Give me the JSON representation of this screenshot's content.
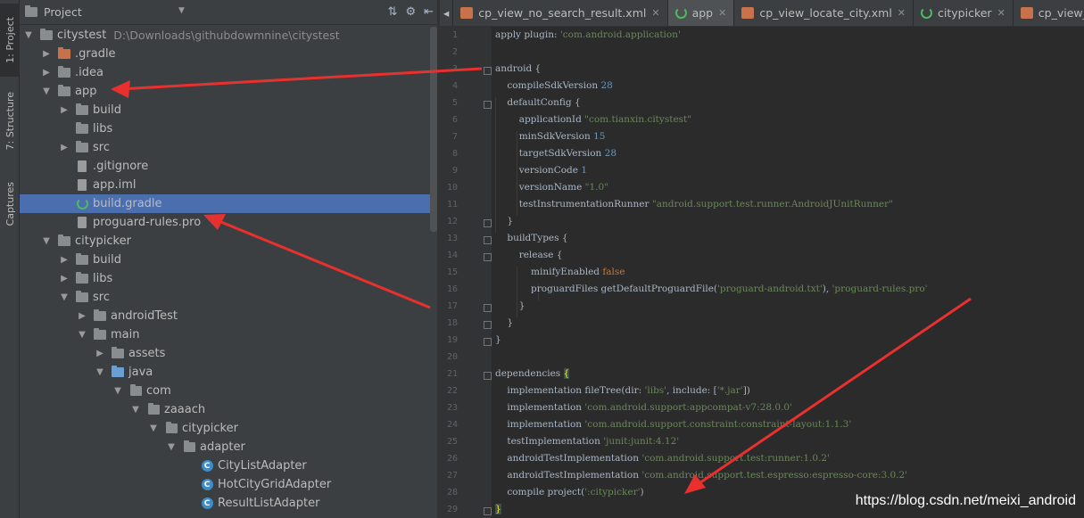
{
  "toolstrip": {
    "tabs": [
      {
        "label": "1: Project"
      },
      {
        "label": "7: Structure"
      },
      {
        "label": "Captures"
      }
    ]
  },
  "project_panel": {
    "title": "Project",
    "root_path": "D:\\Downloads\\githubdowmnine\\citystest",
    "tree": [
      {
        "label": "citystest",
        "depth": 0,
        "expanded": "open",
        "icon": "module-folder-icon"
      },
      {
        "label": ".gradle",
        "depth": 1,
        "expanded": "closed",
        "icon": "orange-folder-icon"
      },
      {
        "label": ".idea",
        "depth": 1,
        "expanded": "closed",
        "icon": "folder-icon"
      },
      {
        "label": "app",
        "depth": 1,
        "expanded": "open",
        "icon": "module-folder-icon"
      },
      {
        "label": "build",
        "depth": 2,
        "expanded": "closed",
        "icon": "folder-icon"
      },
      {
        "label": "libs",
        "depth": 2,
        "expanded": "none",
        "icon": "folder-icon"
      },
      {
        "label": "src",
        "depth": 2,
        "expanded": "closed",
        "icon": "folder-icon"
      },
      {
        "label": ".gitignore",
        "depth": 2,
        "expanded": "none",
        "icon": "file-icon"
      },
      {
        "label": "app.iml",
        "depth": 2,
        "expanded": "none",
        "icon": "file-icon"
      },
      {
        "label": "build.gradle",
        "depth": 2,
        "expanded": "none",
        "icon": "gradle-icon",
        "selected": true
      },
      {
        "label": "proguard-rules.pro",
        "depth": 2,
        "expanded": "none",
        "icon": "file-icon"
      },
      {
        "label": "citypicker",
        "depth": 1,
        "expanded": "open",
        "icon": "module-folder-icon"
      },
      {
        "label": "build",
        "depth": 2,
        "expanded": "closed",
        "icon": "folder-icon"
      },
      {
        "label": "libs",
        "depth": 2,
        "expanded": "closed",
        "icon": "folder-icon"
      },
      {
        "label": "src",
        "depth": 2,
        "expanded": "open",
        "icon": "folder-icon"
      },
      {
        "label": "androidTest",
        "depth": 3,
        "expanded": "closed",
        "icon": "folder-icon"
      },
      {
        "label": "main",
        "depth": 3,
        "expanded": "open",
        "icon": "folder-icon"
      },
      {
        "label": "assets",
        "depth": 4,
        "expanded": "closed",
        "icon": "folder-icon"
      },
      {
        "label": "java",
        "depth": 4,
        "expanded": "open",
        "icon": "blue-folder-icon"
      },
      {
        "label": "com",
        "depth": 5,
        "expanded": "open",
        "icon": "package-icon"
      },
      {
        "label": "zaaach",
        "depth": 6,
        "expanded": "open",
        "icon": "package-icon"
      },
      {
        "label": "citypicker",
        "depth": 7,
        "expanded": "open",
        "icon": "package-icon"
      },
      {
        "label": "adapter",
        "depth": 8,
        "expanded": "open",
        "icon": "package-icon"
      },
      {
        "label": "CityListAdapter",
        "depth": 9,
        "expanded": "none",
        "icon": "class-icon"
      },
      {
        "label": "HotCityGridAdapter",
        "depth": 9,
        "expanded": "none",
        "icon": "class-icon"
      },
      {
        "label": "ResultListAdapter",
        "depth": 9,
        "expanded": "none",
        "icon": "class-icon"
      }
    ]
  },
  "editor": {
    "tabs": [
      {
        "label": "cp_view_no_search_result.xml",
        "icon": "xml-icon",
        "active": false
      },
      {
        "label": "app",
        "icon": "gradle-icon",
        "active": true
      },
      {
        "label": "cp_view_locate_city.xml",
        "icon": "xml-icon",
        "active": false
      },
      {
        "label": "citypicker",
        "icon": "gradle-icon",
        "active": false
      },
      {
        "label": "cp_view_hot_city.",
        "icon": "xml-icon",
        "active": false
      }
    ],
    "line_numbers": [
      "1",
      "2",
      "3",
      "4",
      "5",
      "6",
      "7",
      "8",
      "9",
      "10",
      "11",
      "12",
      "13",
      "14",
      "15",
      "16",
      "17",
      "18",
      "19",
      "20",
      "21",
      "22",
      "23",
      "24",
      "25",
      "26",
      "27",
      "28",
      "29"
    ],
    "lines": [
      [
        {
          "t": "apply plugin: "
        },
        {
          "t": "'com.android.application'",
          "c": "str"
        }
      ],
      [],
      [
        {
          "t": "android {"
        }
      ],
      [
        {
          "t": "    compileSdkVersion "
        },
        {
          "t": "28",
          "c": "num"
        }
      ],
      [
        {
          "t": "    defaultConfig {"
        }
      ],
      [
        {
          "t": "        applicationId "
        },
        {
          "t": "\"com.tianxin.citystest\"",
          "c": "str"
        }
      ],
      [
        {
          "t": "        minSdkVersion "
        },
        {
          "t": "15",
          "c": "num"
        }
      ],
      [
        {
          "t": "        targetSdkVersion "
        },
        {
          "t": "28",
          "c": "num"
        }
      ],
      [
        {
          "t": "        versionCode "
        },
        {
          "t": "1",
          "c": "num"
        }
      ],
      [
        {
          "t": "        versionName "
        },
        {
          "t": "\"1.0\"",
          "c": "str"
        }
      ],
      [
        {
          "t": "        testInstrumentationRunner "
        },
        {
          "t": "\"android.support.test.runner.AndroidJUnitRunner\"",
          "c": "str"
        }
      ],
      [
        {
          "t": "    }"
        }
      ],
      [
        {
          "t": "    buildTypes {"
        }
      ],
      [
        {
          "t": "        release {"
        }
      ],
      [
        {
          "t": "            minifyEnabled "
        },
        {
          "t": "false",
          "c": "kw"
        }
      ],
      [
        {
          "t": "            proguardFiles getDefaultProguardFile("
        },
        {
          "t": "'proguard-android.txt'",
          "c": "str"
        },
        {
          "t": "), "
        },
        {
          "t": "'proguard-rules.pro'",
          "c": "str"
        }
      ],
      [
        {
          "t": "        }"
        }
      ],
      [
        {
          "t": "    }"
        }
      ],
      [
        {
          "t": "}"
        }
      ],
      [],
      [
        {
          "t": "dependencies "
        },
        {
          "t": "{",
          "c": "brace-hl"
        }
      ],
      [
        {
          "t": "    implementation fileTree(dir: "
        },
        {
          "t": "'libs'",
          "c": "str"
        },
        {
          "t": ", include: ["
        },
        {
          "t": "'*.jar'",
          "c": "str"
        },
        {
          "t": "])"
        }
      ],
      [
        {
          "t": "    implementation "
        },
        {
          "t": "'com.android.support:appcompat-v7:28.0.0'",
          "c": "str"
        }
      ],
      [
        {
          "t": "    implementation "
        },
        {
          "t": "'com.android.support.constraint:constraint-layout:1.1.3'",
          "c": "str"
        }
      ],
      [
        {
          "t": "    testImplementation "
        },
        {
          "t": "'junit:junit:4.12'",
          "c": "str"
        }
      ],
      [
        {
          "t": "    androidTestImplementation "
        },
        {
          "t": "'com.android.support.test:runner:1.0.2'",
          "c": "str"
        }
      ],
      [
        {
          "t": "    androidTestImplementation "
        },
        {
          "t": "'com.android.support.test.espresso:espresso-core:3.0.2'",
          "c": "str"
        }
      ],
      [
        {
          "t": "    compile project("
        },
        {
          "t": "':citypicker'",
          "c": "str"
        },
        {
          "t": ")"
        }
      ],
      [
        {
          "t": "}",
          "c": "brace-hl"
        }
      ]
    ]
  },
  "watermark": "https://blog.csdn.net/meixi_android",
  "colors": {
    "panel_bg": "#3c3f41",
    "editor_bg": "#2b2b2b",
    "selection": "#4b6eaf",
    "string": "#6a8759",
    "number": "#6897bb",
    "keyword": "#cc7832",
    "annotation_arrow": "#e8312f"
  }
}
